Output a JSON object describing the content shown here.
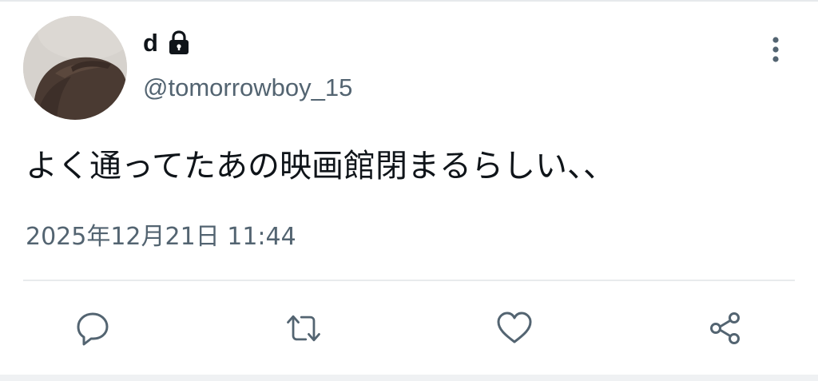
{
  "tweet": {
    "display_name": "d",
    "handle": "@tomorrowboy_15",
    "text": "よく通ってたあの映画館閉まるらしい、、",
    "timestamp": "2025年12月21日 11:44"
  },
  "icons": {
    "protected": "lock-icon",
    "more": "more-vertical-icon",
    "reply": "reply-icon",
    "retweet": "retweet-icon",
    "like": "heart-icon",
    "share": "share-icon"
  },
  "colors": {
    "text_primary": "#0f1419",
    "text_secondary": "#536471",
    "icon": "#536471",
    "divider": "#e8ebed"
  }
}
